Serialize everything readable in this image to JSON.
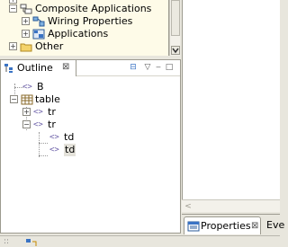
{
  "project_tree": {
    "items": [
      {
        "label": "Composite Applications",
        "icon": "composite-app-icon",
        "expander": "−"
      },
      {
        "label": "Wiring Properties",
        "icon": "wiring-icon",
        "expander": "+"
      },
      {
        "label": "Applications",
        "icon": "applications-icon",
        "expander": "+"
      },
      {
        "label": "Other",
        "icon": "folder-icon",
        "expander": "+"
      }
    ]
  },
  "outline": {
    "title": "Outline",
    "close_glyph": "⊠",
    "tools": [
      "⊟",
      "▽",
      "‒",
      "□"
    ],
    "nodes": [
      {
        "label": "B",
        "kind": "tag",
        "glyph": "<>"
      },
      {
        "label": "table",
        "kind": "table",
        "expander": "−"
      },
      {
        "label": "tr",
        "kind": "tag",
        "glyph": "<>",
        "expander": "+"
      },
      {
        "label": "tr",
        "kind": "tag",
        "glyph": "<>",
        "expander": "−"
      },
      {
        "label": "td",
        "kind": "tag",
        "glyph": "<>"
      },
      {
        "label": "td",
        "kind": "tag",
        "glyph": "<>"
      }
    ]
  },
  "editor": {
    "scroll_left_arrow": "<"
  },
  "tabs": {
    "properties_label": "Properties",
    "properties_close": "⊠",
    "other_label": "Eve"
  },
  "status": {
    "dots": "::"
  }
}
